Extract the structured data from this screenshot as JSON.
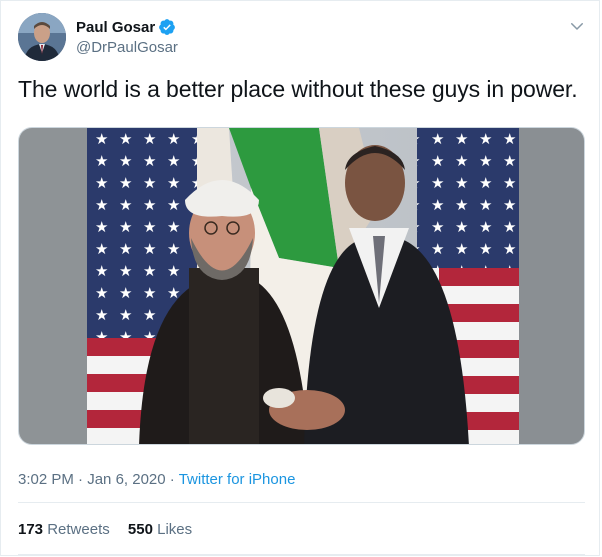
{
  "author": {
    "name": "Paul Gosar",
    "handle": "@DrPaulGosar",
    "verified": true,
    "verified_color": "#1da1f2"
  },
  "tweet": {
    "text": "The world is a better place without these guys in power.",
    "media_icon": "photo"
  },
  "meta": {
    "time": "3:02 PM",
    "separator": "·",
    "date": "Jan 6, 2020",
    "source": "Twitter for iPhone"
  },
  "stats": {
    "retweets_count": "173",
    "retweets_label": "Retweets",
    "likes_count": "550",
    "likes_label": "Likes"
  },
  "colors": {
    "link": "#1b95e0",
    "secondary_text": "#5b7083",
    "primary_text": "#0f1419",
    "border": "#e6ecf0"
  },
  "icons": {
    "menu": "chevron-down-icon",
    "verified": "verified-badge-icon"
  }
}
